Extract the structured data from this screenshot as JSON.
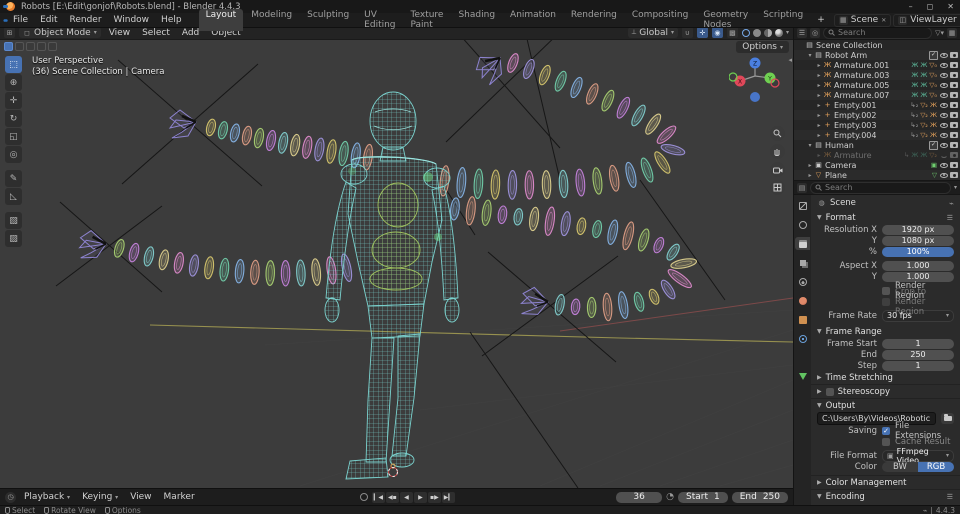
{
  "window": {
    "title": "Robots [E:\\Edit\\gonjof\\Robots.blend] - Blender 4.4.3",
    "minimize": "–",
    "maximize": "◻",
    "close": "✕"
  },
  "topbar": {
    "menus": [
      "File",
      "Edit",
      "Render",
      "Window",
      "Help"
    ],
    "workspaces": [
      "Layout",
      "Modeling",
      "Sculpting",
      "UV Editing",
      "Texture Paint",
      "Shading",
      "Animation",
      "Rendering",
      "Compositing",
      "Geometry Nodes",
      "Scripting"
    ],
    "active_workspace": "Layout",
    "add_workspace": "+",
    "scene_name": "Scene",
    "view_layer_name": "ViewLayer"
  },
  "viewport": {
    "mode": "Object Mode",
    "menus": [
      "View",
      "Select",
      "Add",
      "Object"
    ],
    "orientation": "Global",
    "options_label": "Options",
    "overlay_line1": "User Perspective",
    "overlay_line2": "(36) Scene Collection | Camera",
    "tools": [
      "select-box",
      "cursor",
      "move",
      "rotate",
      "scale",
      "transform",
      "annotate",
      "measure",
      "add-cube",
      "extrude"
    ],
    "nav_icons": [
      "zoom-icon",
      "pan-hand-icon",
      "camera-view-icon",
      "ortho-grid-icon"
    ],
    "gizmo_axes": [
      "X",
      "Y",
      "Z"
    ]
  },
  "outliner": {
    "search_placeholder": "Search",
    "items": [
      {
        "label": "Scene Collection",
        "depth": 0,
        "caret": "",
        "icon": "▤",
        "icolor": "#c9c9c9",
        "badges": [],
        "chk": false,
        "eye": "",
        "cam": false
      },
      {
        "label": "Robot Arm",
        "depth": 1,
        "caret": "▾",
        "icon": "▤",
        "icolor": "#c9c9c9",
        "badges": [],
        "chk": true,
        "eye": "open",
        "cam": true
      },
      {
        "label": "Armature.001",
        "depth": 2,
        "caret": "▸",
        "icon": "Ж",
        "icolor": "#e09f5a",
        "badges": [
          {
            "t": "Ж Ж",
            "c": "bteal"
          },
          {
            "t": "▽₀",
            "c": "borange"
          }
        ],
        "chk": false,
        "eye": "open",
        "cam": true
      },
      {
        "label": "Armature.003",
        "depth": 2,
        "caret": "▸",
        "icon": "Ж",
        "icolor": "#e09f5a",
        "badges": [
          {
            "t": "Ж Ж",
            "c": "bteal"
          },
          {
            "t": "▽₀",
            "c": "borange"
          }
        ],
        "chk": false,
        "eye": "open",
        "cam": true
      },
      {
        "label": "Armature.005",
        "depth": 2,
        "caret": "▸",
        "icon": "Ж",
        "icolor": "#e09f5a",
        "badges": [
          {
            "t": "Ж Ж",
            "c": "bteal"
          },
          {
            "t": "▽₀",
            "c": "borange"
          }
        ],
        "chk": false,
        "eye": "open",
        "cam": true
      },
      {
        "label": "Armature.007",
        "depth": 2,
        "caret": "▸",
        "icon": "Ж",
        "icolor": "#e09f5a",
        "badges": [
          {
            "t": "Ж Ж",
            "c": "bteal"
          },
          {
            "t": "▽₀",
            "c": "borange"
          }
        ],
        "chk": false,
        "eye": "open",
        "cam": true
      },
      {
        "label": "Empty.001",
        "depth": 2,
        "caret": "▸",
        "icon": "+",
        "icolor": "#e09f5a",
        "badges": [
          {
            "t": "↳₂",
            "c": "bgray"
          },
          {
            "t": "▽₂ Ж",
            "c": "borange"
          }
        ],
        "chk": false,
        "eye": "open",
        "cam": true
      },
      {
        "label": "Empty.002",
        "depth": 2,
        "caret": "▸",
        "icon": "+",
        "icolor": "#e09f5a",
        "badges": [
          {
            "t": "↳₂",
            "c": "bgray"
          },
          {
            "t": "▽₂ Ж",
            "c": "borange"
          }
        ],
        "chk": false,
        "eye": "open",
        "cam": true
      },
      {
        "label": "Empty.003",
        "depth": 2,
        "caret": "▸",
        "icon": "+",
        "icolor": "#e09f5a",
        "badges": [
          {
            "t": "↳₂",
            "c": "bgray"
          },
          {
            "t": "▽₂ Ж",
            "c": "borange"
          }
        ],
        "chk": false,
        "eye": "open",
        "cam": true
      },
      {
        "label": "Empty.004",
        "depth": 2,
        "caret": "▸",
        "icon": "+",
        "icolor": "#e09f5a",
        "badges": [
          {
            "t": "↳₂",
            "c": "bgray"
          },
          {
            "t": "▽₂ Ж",
            "c": "borange"
          }
        ],
        "chk": false,
        "eye": "open",
        "cam": true
      },
      {
        "label": "Human",
        "depth": 1,
        "caret": "▾",
        "icon": "▤",
        "icolor": "#c9c9c9",
        "badges": [],
        "chk": true,
        "eye": "open",
        "cam": true
      },
      {
        "label": "Armature",
        "depth": 2,
        "caret": "▸",
        "icon": "Ж",
        "icolor": "#e09f5a",
        "badges": [
          {
            "t": "↳",
            "c": "bgray"
          },
          {
            "t": "Ж Ж",
            "c": "bteal"
          },
          {
            "t": "▽₂",
            "c": "borange"
          }
        ],
        "chk": false,
        "eye": "closed",
        "cam": true,
        "dim": true
      },
      {
        "label": "Camera",
        "depth": 1,
        "caret": "▸",
        "icon": "▣",
        "icolor": "#c9c9c9",
        "badges": [
          {
            "t": "▣",
            "c": "bgreen2"
          }
        ],
        "chk": false,
        "eye": "open",
        "cam": true
      },
      {
        "label": "Plane",
        "depth": 1,
        "caret": "▸",
        "icon": "▽",
        "icolor": "#e09f5a",
        "badges": [
          {
            "t": "▽",
            "c": "bgreen2"
          }
        ],
        "chk": false,
        "eye": "open",
        "cam": true
      }
    ]
  },
  "properties": {
    "search_placeholder": "Search",
    "breadcrumb": "Scene",
    "tabs": [
      "tool",
      "render",
      "output",
      "view-layer",
      "scene",
      "world",
      "object",
      "physics",
      "constraints",
      "object-data"
    ],
    "active_tab": "output",
    "format": {
      "title": "Format",
      "rows": [
        {
          "label": "Resolution X",
          "value": "1920 px"
        },
        {
          "label": "Y",
          "value": "1080 px"
        },
        {
          "label": "%",
          "value": "100%"
        },
        {
          "label": "Aspect X",
          "value": "1.000"
        },
        {
          "label": "Y",
          "value": "1.000"
        }
      ],
      "render_region": "Render Region",
      "crop_region": "Crop to Render Region",
      "frame_rate_label": "Frame Rate",
      "frame_rate": "30 fps"
    },
    "frame_range": {
      "title": "Frame Range",
      "rows": [
        {
          "label": "Frame Start",
          "value": "1"
        },
        {
          "label": "End",
          "value": "250"
        },
        {
          "label": "Step",
          "value": "1"
        }
      ],
      "time_stretching": "Time Stretching"
    },
    "stereoscopy": "Stereoscopy",
    "output": {
      "title": "Output",
      "path": "C:\\Users\\By\\Videos\\Robotic",
      "saving_label": "Saving",
      "file_extensions": "File Extensions",
      "cache_result": "Cache Result",
      "file_format_label": "File Format",
      "file_format": "FFmpeg Video",
      "color_label": "Color",
      "color_bw": "BW",
      "color_rgb": "RGB",
      "color_management": "Color Management",
      "encoding": "Encoding"
    }
  },
  "timeline": {
    "menus": [
      "Playback",
      "Keying",
      "View",
      "Marker"
    ],
    "current_frame": "36",
    "start_label": "Start",
    "start_value": "1",
    "end_label": "End",
    "end_value": "250"
  },
  "statusbar": {
    "hints": [
      "Select",
      "Rotate View",
      "Options"
    ],
    "version": "4.4.3"
  },
  "colors": {
    "accent_blue": "#4772b3",
    "viewport_bg": "#3c3c3c",
    "wire_cyan": "#7ad1cd",
    "wire_olive": "#9fc25e",
    "claw_purple": "#8d83cf",
    "tentacle_palette": [
      "#d887c6",
      "#9a8fd6",
      "#cfc06b",
      "#6fc9a6",
      "#82aede",
      "#d89a82",
      "#a3c96f",
      "#c07fd6",
      "#7fc9c9",
      "#d6c98a"
    ]
  }
}
